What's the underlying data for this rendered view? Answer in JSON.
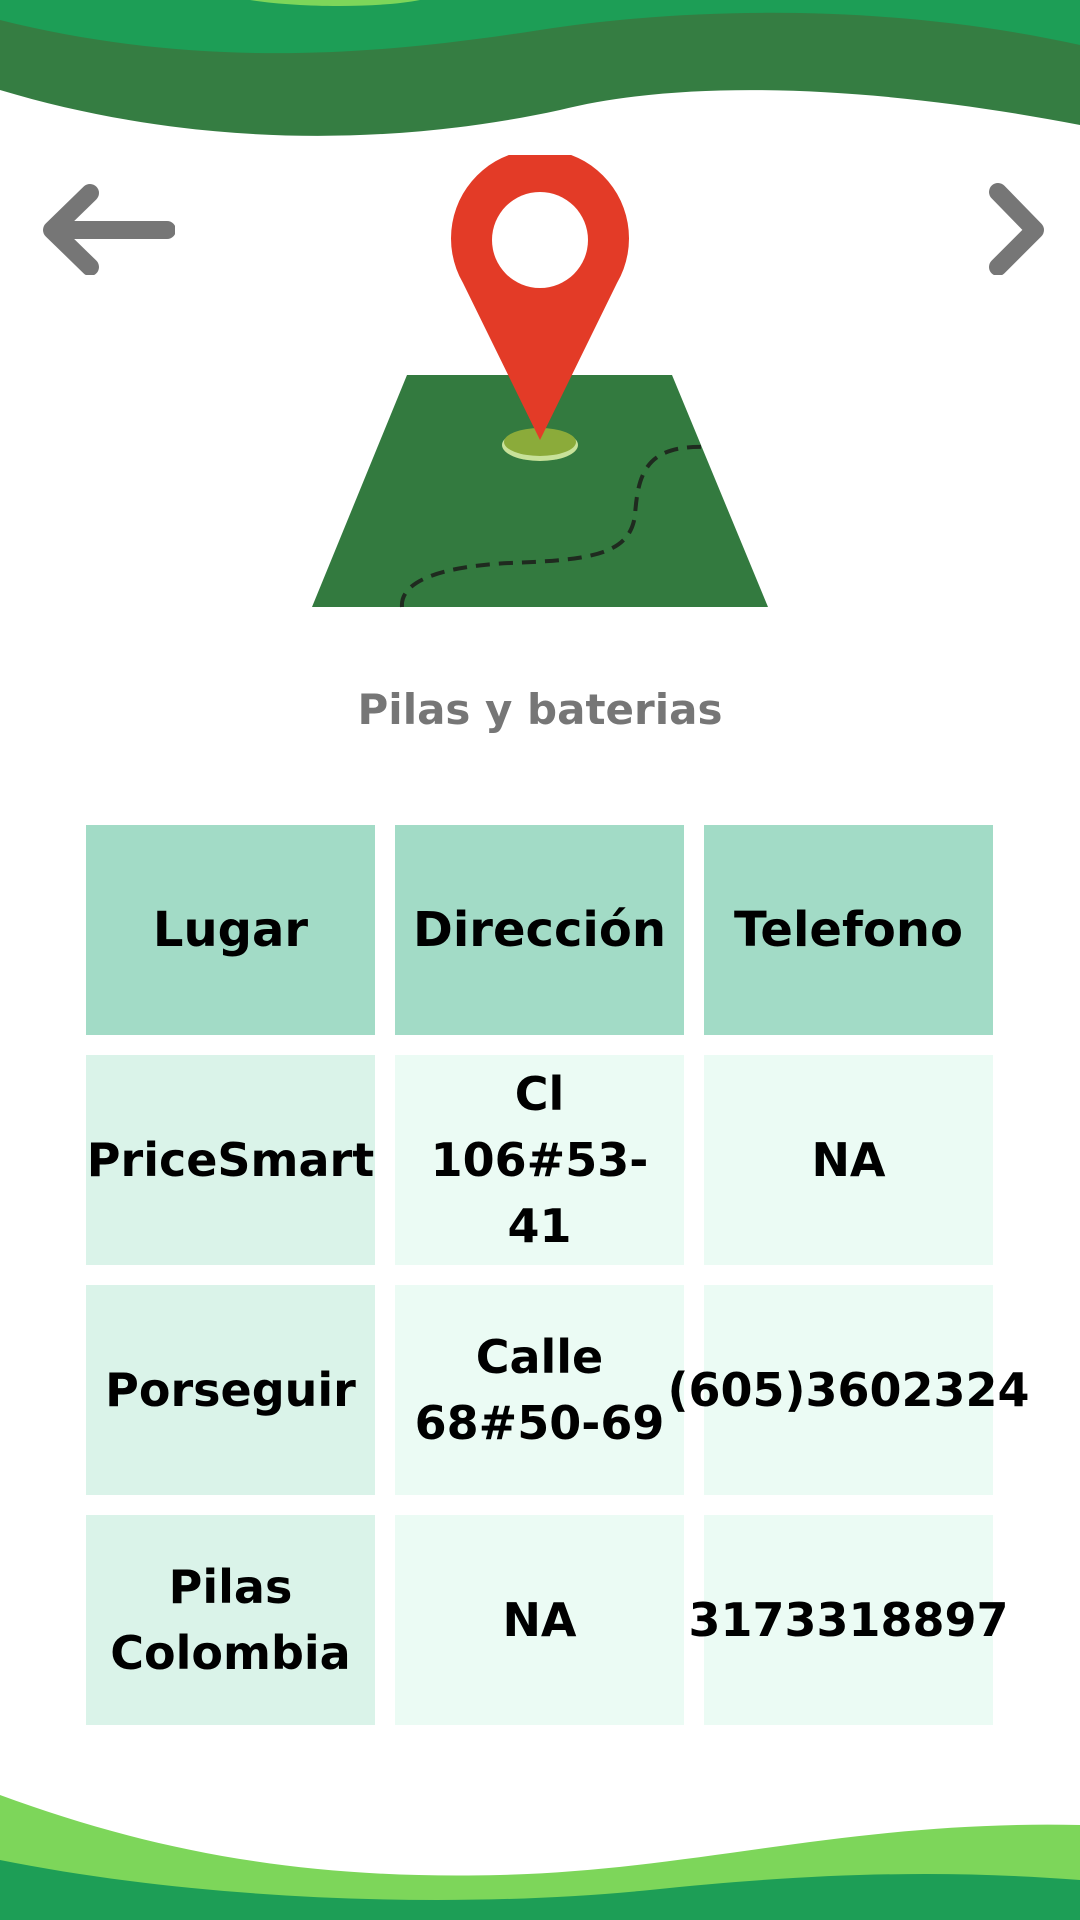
{
  "nav": {
    "back_icon": "arrow-left-icon",
    "next_icon": "chevron-right-icon"
  },
  "hero": {
    "icon": "map-pin-on-map-icon"
  },
  "title": "Pilas y baterias",
  "table": {
    "headers": [
      "Lugar",
      "Dirección",
      "Telefono"
    ],
    "rows": [
      [
        "PriceSmart",
        "Cl 106#53-41",
        "NA"
      ],
      [
        "Porseguir",
        "Calle 68#50-69",
        "(605)3602324"
      ],
      [
        "Pilas Colombia",
        "NA",
        "3173318897"
      ]
    ]
  },
  "colors": {
    "header_bg": "#a2dbc6",
    "first_col_bg": "#daf3e9",
    "cell_bg": "#ebfbf4",
    "wave_dark": "#357d42",
    "wave_mid": "#1d9e56",
    "wave_light": "#7dd65a",
    "pin": "#e33b27",
    "map": "#337a3f"
  }
}
